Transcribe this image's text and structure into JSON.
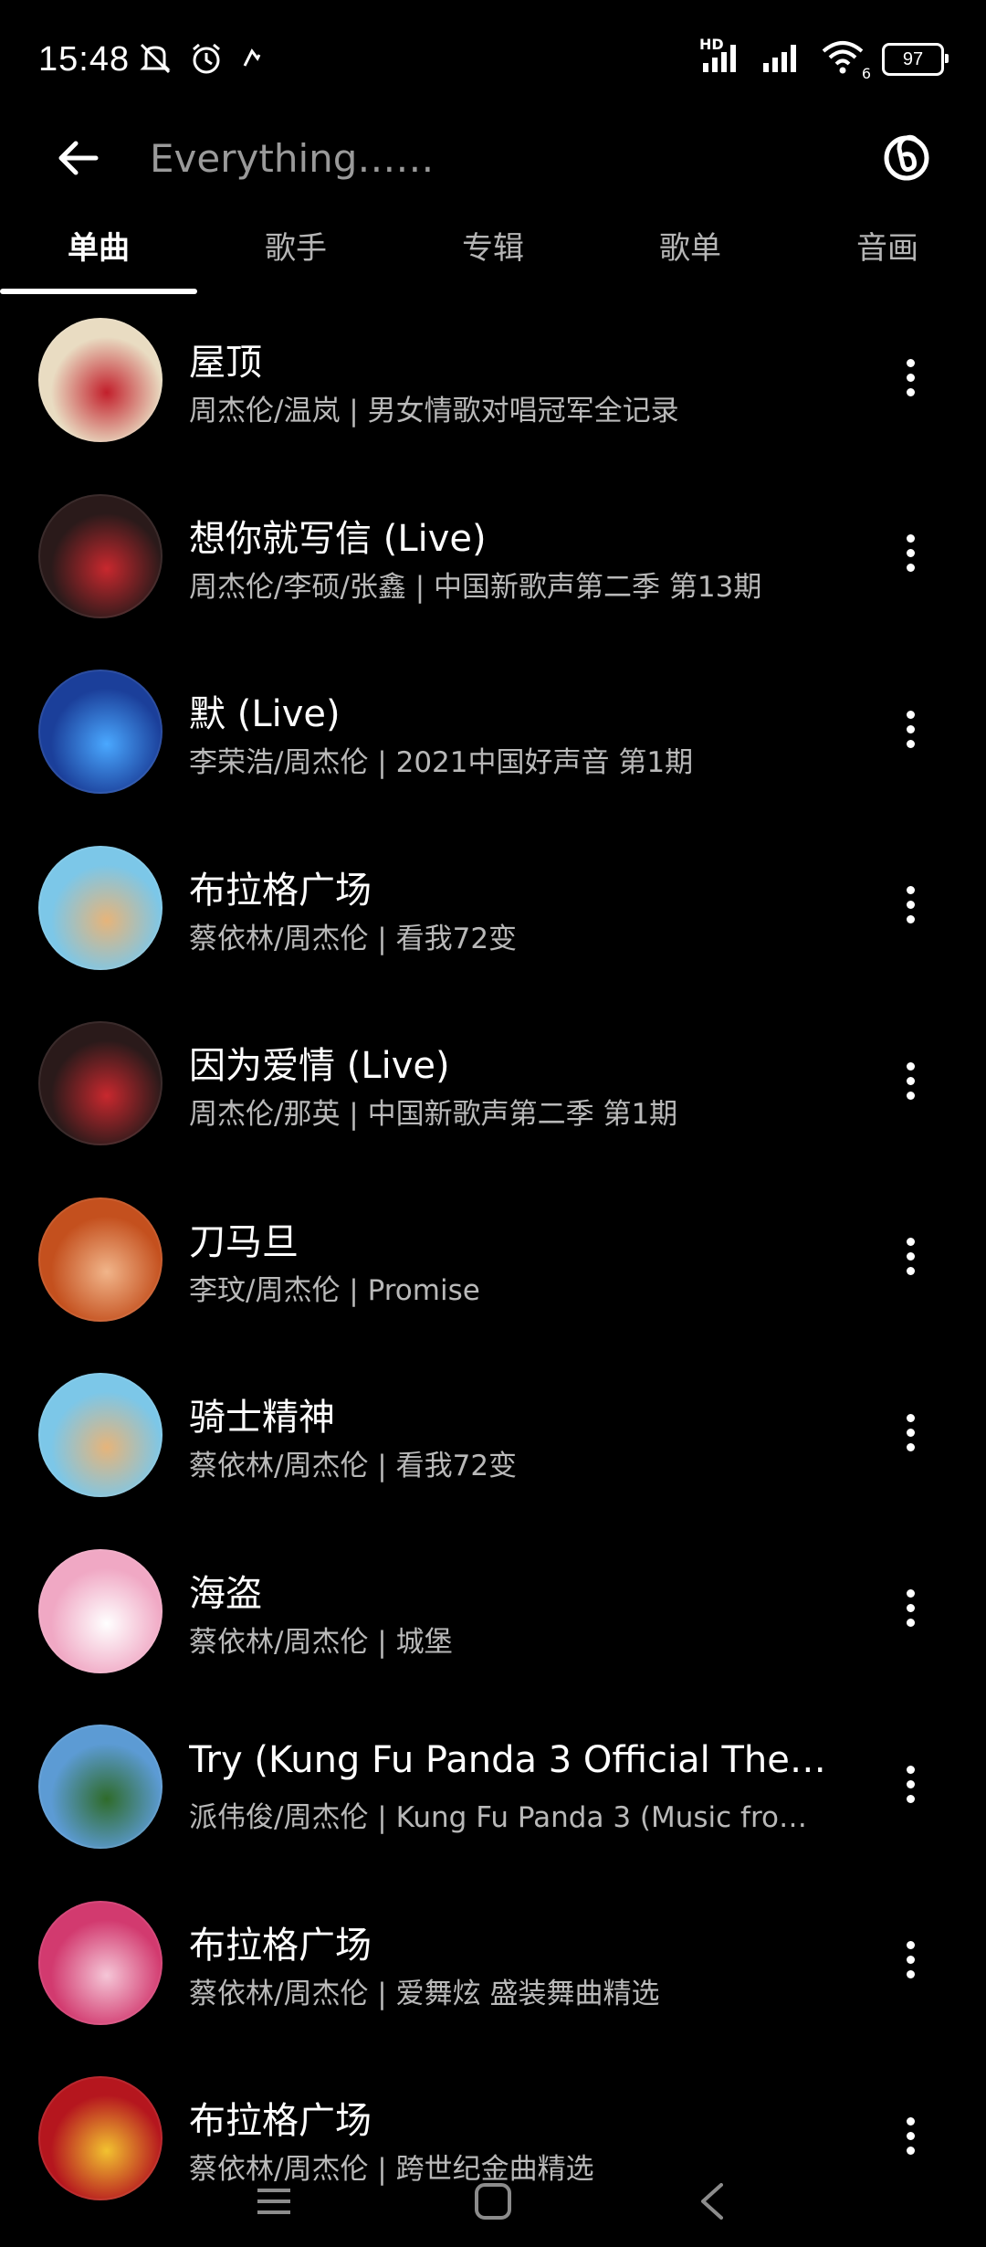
{
  "status_bar": {
    "time": "15:48",
    "battery": "97",
    "icons": [
      "mute-icon",
      "alarm-icon",
      "app-notification-icon",
      "hd-signal-icon",
      "signal-icon",
      "wifi-icon",
      "battery-icon"
    ],
    "hd_label": "HD",
    "wifi_badge": "6"
  },
  "header": {
    "search_placeholder": "Everything……"
  },
  "tabs": [
    {
      "label": "单曲",
      "active": true
    },
    {
      "label": "歌手",
      "active": false
    },
    {
      "label": "专辑",
      "active": false
    },
    {
      "label": "歌单",
      "active": false
    },
    {
      "label": "音画",
      "active": false
    }
  ],
  "songs": [
    {
      "title": "屋顶",
      "subtitle": "周杰伦/温岚 |  男女情歌对唱冠军全记录",
      "cover_color": "#e9dcc2",
      "cover_accent": "#c21f2b"
    },
    {
      "title": "想你就写信 (Live)",
      "subtitle": "周杰伦/李硕/张鑫 |  中国新歌声第二季 第13期",
      "cover_color": "#2a1a1a",
      "cover_accent": "#c8282e"
    },
    {
      "title": "默 (Live)",
      "subtitle": "李荣浩/周杰伦 |  2021中国好声音 第1期",
      "cover_color": "#1b3f9a",
      "cover_accent": "#4aa8ff"
    },
    {
      "title": "布拉格广场",
      "subtitle": "蔡依林/周杰伦 |  看我72变",
      "cover_color": "#7cc7e8",
      "cover_accent": "#e6b47a"
    },
    {
      "title": "因为爱情 (Live)",
      "subtitle": "周杰伦/那英 |  中国新歌声第二季 第1期",
      "cover_color": "#2a1a1a",
      "cover_accent": "#c8282e"
    },
    {
      "title": "刀马旦",
      "subtitle": "李玟/周杰伦 |  Promise",
      "cover_color": "#c4501e",
      "cover_accent": "#f1b58a"
    },
    {
      "title": "骑士精神",
      "subtitle": "蔡依林/周杰伦 |  看我72变",
      "cover_color": "#7cc7e8",
      "cover_accent": "#e6b47a"
    },
    {
      "title": "海盗",
      "subtitle": "蔡依林/周杰伦 |  城堡",
      "cover_color": "#f0a8c4",
      "cover_accent": "#ffffff"
    },
    {
      "title": "Try (Kung Fu Panda 3 Official The…",
      "subtitle": "派伟俊/周杰伦 |  Kung Fu Panda 3 (Music fro…",
      "cover_color": "#5c9bd4",
      "cover_accent": "#2f6b2a"
    },
    {
      "title": "布拉格广场",
      "subtitle": "蔡依林/周杰伦 |  爱舞炫 盛装舞曲精选",
      "cover_color": "#d23a6f",
      "cover_accent": "#f5c6d7"
    },
    {
      "title": "布拉格广场",
      "subtitle": "蔡依林/周杰伦 |  跨世纪金曲精选",
      "cover_color": "#b5161e",
      "cover_accent": "#f2c230"
    }
  ],
  "navbar": {
    "icons": [
      "menu-icon",
      "home-icon",
      "back-icon"
    ]
  }
}
